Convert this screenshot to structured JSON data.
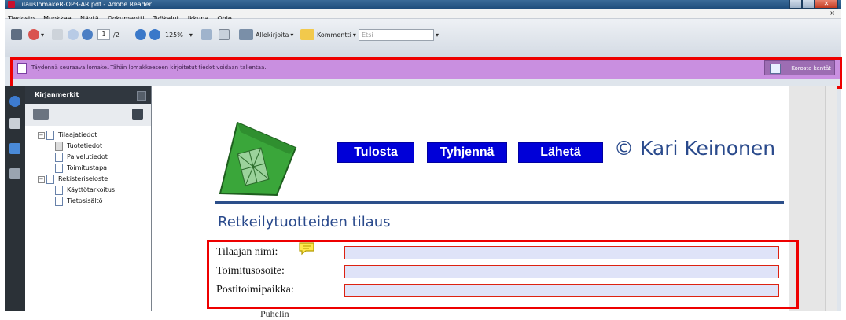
{
  "window": {
    "title": "TilauslomakeR-OP3-AR.pdf - Adobe Reader"
  },
  "menubar": {
    "items": [
      "Tiedosto",
      "Muokkaa",
      "Näytä",
      "Dokumentti",
      "Työkalut",
      "Ikkuna",
      "Ohje"
    ],
    "close_glyph": "×"
  },
  "toolbar": {
    "current_page": "1",
    "page_count": "/2",
    "zoom": "125%",
    "sign_label": "Allekirjoita",
    "comment_label": "Kommentti",
    "search_placeholder": "Etsi"
  },
  "notification": {
    "message": "Täydennä seuraava lomake. Tähän lomakkeeseen kirjoitetut tiedot voidaan tallentaa.",
    "highlight_button": "Korosta kentät",
    "bar_color": "#c98fe0"
  },
  "bookmarks": {
    "title": "Kirjanmerkit",
    "items": [
      {
        "label": "Tilaajatiedot",
        "level": 0,
        "expander": "−"
      },
      {
        "label": "Tuotetiedot",
        "level": 1
      },
      {
        "label": "Palvelutiedot",
        "level": 1
      },
      {
        "label": "Toimitustapa",
        "level": 1
      },
      {
        "label": "Rekisteriseloste",
        "level": 0,
        "expander": "−"
      },
      {
        "label": "Käyttötarkoitus",
        "level": 1
      },
      {
        "label": "Tietosisältö",
        "level": 1
      }
    ]
  },
  "document": {
    "buttons": {
      "print": "Tulosta",
      "clear": "Tyhjennä",
      "send": "Lähetä"
    },
    "copyright": "© Kari Keinonen",
    "form_title": "Retkeilytuotteiden tilaus",
    "fields": [
      {
        "label": "Tilaajan nimi:",
        "value": ""
      },
      {
        "label": "Toimitusosoite:",
        "value": ""
      },
      {
        "label": "Postitoimipaikka:",
        "value": ""
      }
    ],
    "partial_label": "Puhelin",
    "accent_color": "#0000d8",
    "heading_color": "#2a4a8c"
  }
}
